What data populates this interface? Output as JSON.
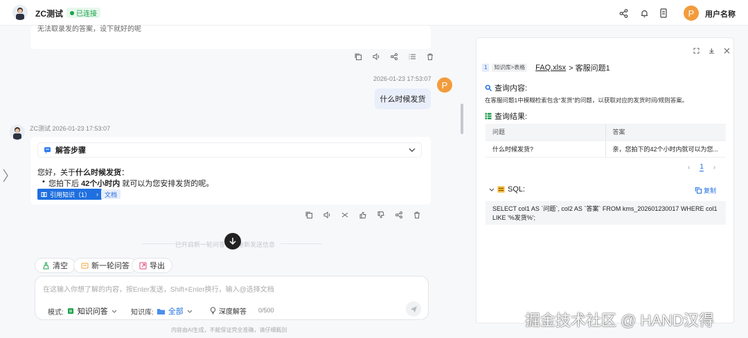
{
  "header": {
    "title": "ZC测试",
    "status": "已连接",
    "username": "用户名称",
    "avatar_letter": "P"
  },
  "chat": {
    "prev_text": "无法取录发的答案，设下就好的呢",
    "user_time": "2026-01-23 17:53:07",
    "user_avatar": "P",
    "user_message": "什么时候发货",
    "bot_name_time": "ZC测试 2026-01-23 17:53:07",
    "steps_title": "解答步骤",
    "answer_prefix": "您好，关于",
    "answer_bold": "什么时候发货",
    "answer_colon": "：",
    "bullet_pre": "您拍下后 ",
    "bullet_bold": "42个小时内",
    "bullet_post": " 就可以为您安排发货的呢。",
    "cite_label": "引用知识（1）",
    "cite_doc": "文档",
    "divider": "已开启新一轮问答，请重新发送信息"
  },
  "actions": {
    "clear": "清空",
    "new_round": "新一轮问答",
    "export": "导出"
  },
  "input": {
    "placeholder": "在这输入你想了解的内容，按Enter发送，Shift+Enter换行，输入@选择文档",
    "mode_label": "模式:",
    "mode_value": "知识问答",
    "kb_label": "知识库:",
    "kb_value": "全部",
    "deep": "深度解答",
    "count": "0/500"
  },
  "disclaimer": "内容由AI生成，不能保证完全准确，请仔细甄别",
  "panel": {
    "num": "1",
    "tag": "知识库>表格",
    "file": "FAQ.xlsx",
    "path": " > 客服问题1",
    "query_title": "查询内容:",
    "query_desc": "在客服问题1中模糊检索包含“发货”的问题，以获取对应的发货时间/规则答案。",
    "result_title": "查询结果:",
    "columns": [
      "问题",
      "答案"
    ],
    "rows": [
      [
        "什么时候发货?",
        "亲，您拍下的42个小时内就可以为您..."
      ]
    ],
    "page": "1",
    "sql_title": "SQL:",
    "copy": "复制",
    "sql": "SELECT col1 AS `问题`, col2 AS `答案` FROM kms_202601230017 WHERE col1 LIKE '%发货%';"
  },
  "watermark": "掘金技术社区 @ HAND汉得",
  "colors": {
    "accent": "#1f6fe0",
    "status": "#19a34a",
    "avatar": "#f39b3c"
  }
}
